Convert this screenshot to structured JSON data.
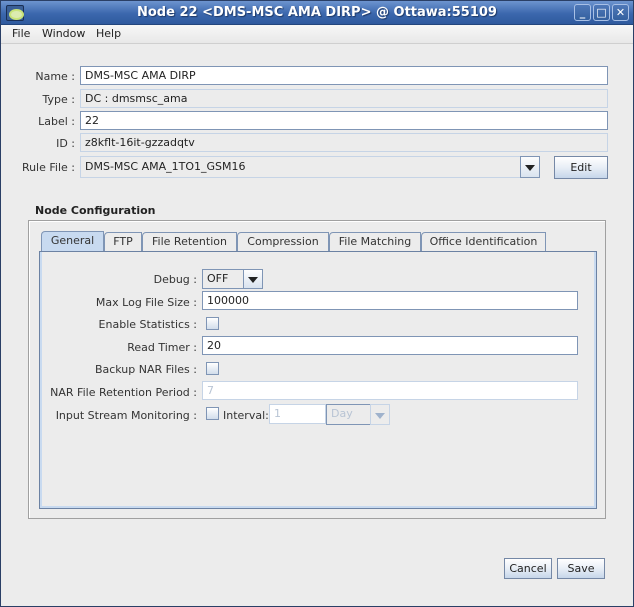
{
  "window": {
    "title": "Node 22 <DMS-MSC AMA DIRP> @ Ottawa:55109",
    "controls": {
      "minimize": "_",
      "maximize": "□",
      "close": "✕"
    }
  },
  "menubar": {
    "items": [
      "File",
      "Window",
      "Help"
    ]
  },
  "form": {
    "name": {
      "label": "Name :",
      "value": "DMS-MSC AMA DIRP"
    },
    "type": {
      "label": "Type :",
      "value": "DC : dmsmsc_ama"
    },
    "label": {
      "label": "Label :",
      "value": "22"
    },
    "id": {
      "label": "ID :",
      "value": "z8kflt-16it-gzzadqtv"
    },
    "rule_file": {
      "label": "Rule File :",
      "value": "DMS-MSC AMA_1TO1_GSM16",
      "edit_button": "Edit"
    }
  },
  "node_config": {
    "title": "Node Configuration",
    "tabs": [
      "General",
      "FTP",
      "File Retention",
      "Compression",
      "File Matching",
      "Office Identification"
    ],
    "active_tab": "General",
    "general": {
      "debug": {
        "label": "Debug :",
        "value": "OFF"
      },
      "max_log_file_size": {
        "label": "Max Log File Size :",
        "value": "100000"
      },
      "enable_statistics": {
        "label": "Enable Statistics :",
        "checked": false
      },
      "read_timer": {
        "label": "Read Timer :",
        "value": "20"
      },
      "backup_nar_files": {
        "label": "Backup NAR Files :",
        "checked": false
      },
      "nar_file_retention_period": {
        "label": "NAR File Retention Period :",
        "value": "7"
      },
      "input_stream_monitoring": {
        "label": "Input Stream Monitoring :",
        "checked": false,
        "interval_label": "Interval:",
        "interval_value": "1",
        "interval_unit": "Day"
      }
    }
  },
  "buttons": {
    "cancel": "Cancel",
    "save": "Save"
  }
}
